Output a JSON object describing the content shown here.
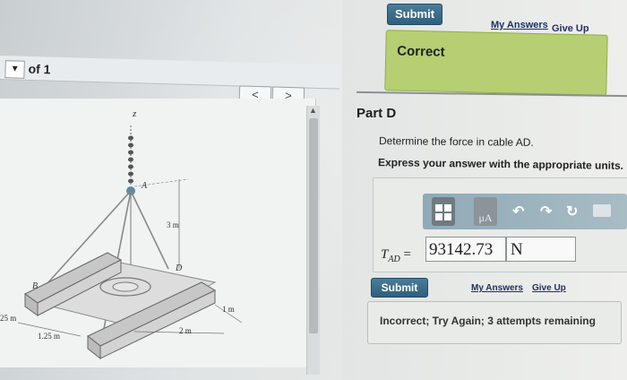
{
  "top": {
    "submit_label": "Submit",
    "my_answers_label": "My Answers",
    "give_up_label": "Give Up"
  },
  "feedback_correct": "Correct",
  "viewer": {
    "page_of": "of 1",
    "prev_label": "<",
    "next_label": ">"
  },
  "figure": {
    "z_label": "z",
    "a_label": "A",
    "b_label": "B",
    "d_label": "D",
    "dim_3m": "3 m",
    "dim_1m": "1 m",
    "dim_2m": "2 m",
    "dim_125m": "1.25 m",
    "dim_25m": "25 m"
  },
  "part": {
    "title": "Part D",
    "question": "Determine the force in cable AD.",
    "instruction": "Express your answer with the appropriate units."
  },
  "answer": {
    "label_main": "T",
    "label_sub": "AD",
    "equals": "=",
    "value": "93142.73",
    "unit": "N",
    "units_button": "μA"
  },
  "bottom": {
    "submit_label": "Submit",
    "my_answers_label": "My Answers",
    "give_up_label": "Give Up"
  },
  "feedback_incorrect": "Incorrect; Try Again; 3 attempts remaining",
  "colors": {
    "submit_bg": "#2f5f7c",
    "correct_bg": "#b6cf72",
    "link": "#1e2f63"
  },
  "icons": [
    "templates-icon",
    "units-icon",
    "undo-icon",
    "redo-icon",
    "reset-icon",
    "keyboard-icon",
    "caret-down-icon",
    "chevron-left-icon",
    "chevron-right-icon",
    "scroll-up-icon"
  ]
}
